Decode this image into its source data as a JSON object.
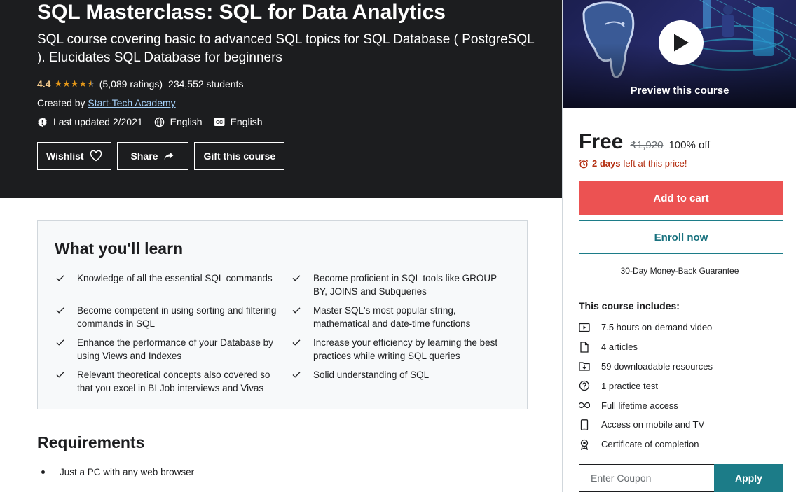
{
  "header": {
    "title": "SQL Masterclass: SQL for Data Analytics",
    "subtitle": "SQL course covering basic to advanced SQL topics for SQL Database ( PostgreSQL ). Elucidates SQL Database for beginners",
    "rating_value": "4.4",
    "rating_stars": 4.4,
    "ratings_count": "(5,089 ratings)",
    "students": "234,552 students",
    "created_by_label": "Created by",
    "author": "Start-Tech Academy",
    "last_updated": "Last updated 2/2021",
    "language": "English",
    "captions": "English",
    "wishlist_label": "Wishlist",
    "share_label": "Share",
    "gift_label": "Gift this course"
  },
  "sidebar": {
    "preview_label": "Preview this course",
    "price": "Free",
    "original_price": "₹1,920",
    "discount": "100% off",
    "deadline_bold": "2 days",
    "deadline_rest": "left at this price!",
    "add_to_cart": "Add to cart",
    "enroll_now": "Enroll now",
    "guarantee": "30-Day Money-Back Guarantee",
    "includes_title": "This course includes:",
    "includes": [
      {
        "icon": "video-icon",
        "label": "7.5 hours on-demand video"
      },
      {
        "icon": "file-icon",
        "label": "4 articles"
      },
      {
        "icon": "download-folder-icon",
        "label": "59 downloadable resources"
      },
      {
        "icon": "question-icon",
        "label": "1 practice test"
      },
      {
        "icon": "infinity-icon",
        "label": "Full lifetime access"
      },
      {
        "icon": "mobile-icon",
        "label": "Access on mobile and TV"
      },
      {
        "icon": "certificate-icon",
        "label": "Certificate of completion"
      }
    ],
    "coupon_placeholder": "Enter Coupon",
    "apply_label": "Apply"
  },
  "learn": {
    "title": "What you'll learn",
    "items": [
      "Knowledge of all the essential SQL commands",
      "Become proficient in SQL tools like GROUP BY, JOINS and Subqueries",
      "Become competent in using sorting and filtering commands in SQL",
      "Master SQL's most popular string, mathematical and date-time functions",
      "Enhance the performance of your Database by using Views and Indexes",
      "Increase your efficiency by learning the best practices while writing SQL queries",
      "Relevant theoretical concepts also covered so that you excel in BI Job interviews and Vivas",
      "Solid understanding of SQL"
    ]
  },
  "requirements": {
    "title": "Requirements",
    "items": [
      "Just a PC with any web browser"
    ]
  },
  "colors": {
    "header_bg": "#1c1d1f",
    "rating": "#f3ca8c",
    "star": "#e59819",
    "add_to_cart": "#ec5252",
    "teal": "#1c7c88",
    "deadline": "#b32d0f"
  }
}
